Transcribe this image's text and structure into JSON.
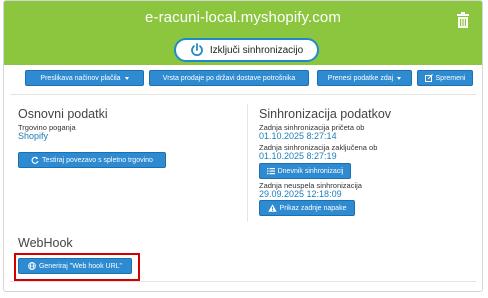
{
  "header": {
    "title": "e-racuni-local.myshopify.com",
    "sync_toggle_label": "Izključi sinhronizacijo"
  },
  "toolbar": {
    "payment_mapping": "Preslikava načinov plačila",
    "sales_type": "Vrsta prodaje po državi dostave potrošnika",
    "transfer_data": "Prenesi podatke zdaj",
    "save": "Spremeni"
  },
  "basic": {
    "title": "Osnovni podatki",
    "platform_label": "Trgovino poganja",
    "platform_value": "Shopify",
    "test_button": "Testiraj povezavo s spletno trgovino"
  },
  "sync": {
    "title": "Sinhronizacija podatkov",
    "last_start_label": "Zadnja sinhronizacija pričeta ob",
    "last_start_value": "01.10.2025 8:27:14",
    "last_end_label": "Zadnja sinhronizacija zaključena ob",
    "last_end_value": "01.10.2025 8:27:19",
    "log_button": "Dnevnik sinhronizacij",
    "last_failed_label": "Zadnja neuspela sinhronizacija",
    "last_failed_value": "29.09.2025 12:18:09",
    "error_button": "Prikaz zadnje napake"
  },
  "webhook": {
    "title": "WebHook",
    "generate_button": "Generiraj \"Web hook URL\""
  },
  "colors": {
    "header_bg": "#8cc63f",
    "button_bg": "#2e8bd1",
    "value_text": "#1a7fb8",
    "highlight": "#d40000"
  }
}
